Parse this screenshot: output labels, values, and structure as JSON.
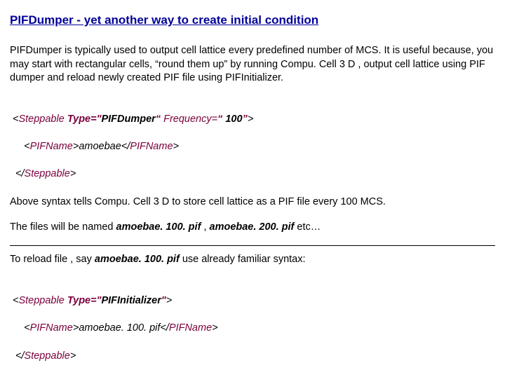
{
  "title": "PIFDumper - yet another way to create initial condition",
  "intro": "PIFDumper is typically used to output cell lattice every predefined number of MCS. It is useful because, you may start with rectangular cells, “round them up” by running Compu. Cell 3 D , output cell lattice using PIF dumper and reload newly created PIF file using PIFInitializer.",
  "code1": {
    "l1": {
      "lt": "<",
      "steppable": "Steppable",
      "space1": " ",
      "typeAttr": "Type=\"",
      "typeVal": "PIFDumper",
      "typeClose": "“ ",
      "freqAttr": "Frequency=",
      "freqOpen": "“ ",
      "freqVal": "100",
      "freqClose": "”",
      "gt": ">"
    },
    "l2": {
      "indent": "    ",
      "lt": "<",
      "pifname": "PIFName",
      "gt1": ">",
      "text": "amoebae",
      "lt2": "</",
      "pifname2": "PIFName",
      "gt2": ">"
    },
    "l3": {
      "indent": " ",
      "lt": "</",
      "steppable": "Steppable",
      "gt": ">"
    }
  },
  "explain1": "Above syntax tells Compu. Cell 3 D to store cell lattice as a PIF file every 100 MCS.",
  "explain2_a": "The files will be named ",
  "explain2_b": "amoebae. 100. pif",
  "explain2_c": " , ",
  "explain2_d": "amoebae. 200. pif",
  "explain2_e": " etc…",
  "explain3_a": "To reload file , say ",
  "explain3_b": "amoebae. 100. pif",
  "explain3_c": " use already familiar syntax:",
  "code2": {
    "l1": {
      "lt": "<",
      "steppable": "Steppable",
      "space1": " ",
      "typeAttr": "Type=\"",
      "typeVal": "PIFInitializer",
      "typeClose": "\"",
      "gt": ">"
    },
    "l2": {
      "indent": "    ",
      "lt": "<",
      "pifname": "PIFName",
      "gt1": ">",
      "text": "amoebae. 100. pif",
      "lt2": "</",
      "pifname2": "PIFName",
      "gt2": ">"
    },
    "l3": {
      "indent": " ",
      "lt": "</",
      "steppable": "Steppable",
      "gt": ">"
    }
  }
}
